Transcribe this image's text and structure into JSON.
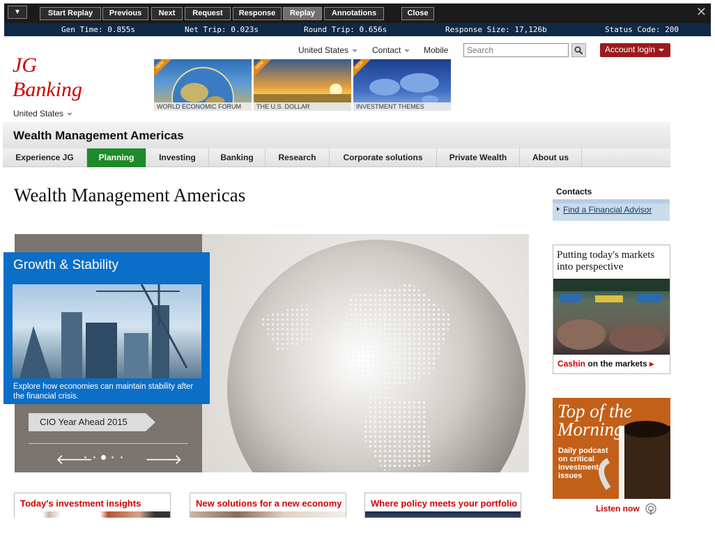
{
  "toolbar": {
    "menu_icon": "caret-down-icon",
    "buttons": [
      {
        "label": "Start Replay",
        "active": false
      },
      {
        "label": "Previous",
        "active": false
      },
      {
        "label": "Next",
        "active": false
      },
      {
        "label": "Request",
        "active": false
      },
      {
        "label": "Response",
        "active": false
      },
      {
        "label": "Replay",
        "active": true
      },
      {
        "label": "Annotations",
        "active": false
      }
    ],
    "close_label": "Close",
    "close_icon": "x-icon",
    "colors": {
      "bg": "#1b1b1b",
      "active": "#6f6f6f",
      "status_bg": "#0f2a46"
    }
  },
  "status": {
    "gen_time": "Gen Time: 0.855s",
    "net_trip": "Net Trip: 0.023s",
    "round_trip": "Round Trip: 0.656s",
    "response_size": "Response Size: 17,126b",
    "status_code": "Status Code: 200"
  },
  "header": {
    "logo_line1": "JG",
    "logo_line2": "Banking",
    "region": "United States",
    "topnav": {
      "country": "United States",
      "contact": "Contact",
      "mobile": "Mobile"
    },
    "search": {
      "placeholder": "Search",
      "icon": "search-icon"
    },
    "login_label": "Account login",
    "banners": [
      {
        "caption": "WORLD ECONOMIC FORUM",
        "tag": "NEW"
      },
      {
        "caption": "THE U.S. DOLLAR",
        "tag": "NEW"
      },
      {
        "caption": "INVESTMENT THEMES",
        "tag": "NEW"
      }
    ]
  },
  "section": {
    "title": "Wealth Management Americas",
    "nav": [
      {
        "label": "Experience JG",
        "active": false
      },
      {
        "label": "Planning",
        "active": true
      },
      {
        "label": "Investing",
        "active": false
      },
      {
        "label": "Banking",
        "active": false
      },
      {
        "label": "Research",
        "active": false
      },
      {
        "label": "Corporate solutions",
        "active": false
      },
      {
        "label": "Private Wealth",
        "active": false
      },
      {
        "label": "About us",
        "active": false
      }
    ]
  },
  "main": {
    "heading": "Wealth Management Americas",
    "hero": {
      "callout_title": "Growth & Stability",
      "callout_text": "Explore how economies can maintain stability after the financial crisis.",
      "cio_label": "CIO Year Ahead 2015",
      "slide_count": 5,
      "active_slide": 3
    },
    "tiles": [
      {
        "title": "Today's investment insights"
      },
      {
        "title": "New solutions for a new economy"
      },
      {
        "title": "Where policy meets your portfolio"
      }
    ]
  },
  "sidebar": {
    "contacts_heading": "Contacts",
    "advisor_link": "Find a Financial Advisor",
    "ad1": {
      "title": "Putting today's markets into perspective",
      "cta_brand": "Cashin",
      "cta_text": "on the markets"
    },
    "ad2": {
      "title_line1": "Top of the",
      "title_line2": "Morning",
      "subtitle": "Daily podcast on critical investment issues",
      "cta": "Listen now"
    }
  }
}
